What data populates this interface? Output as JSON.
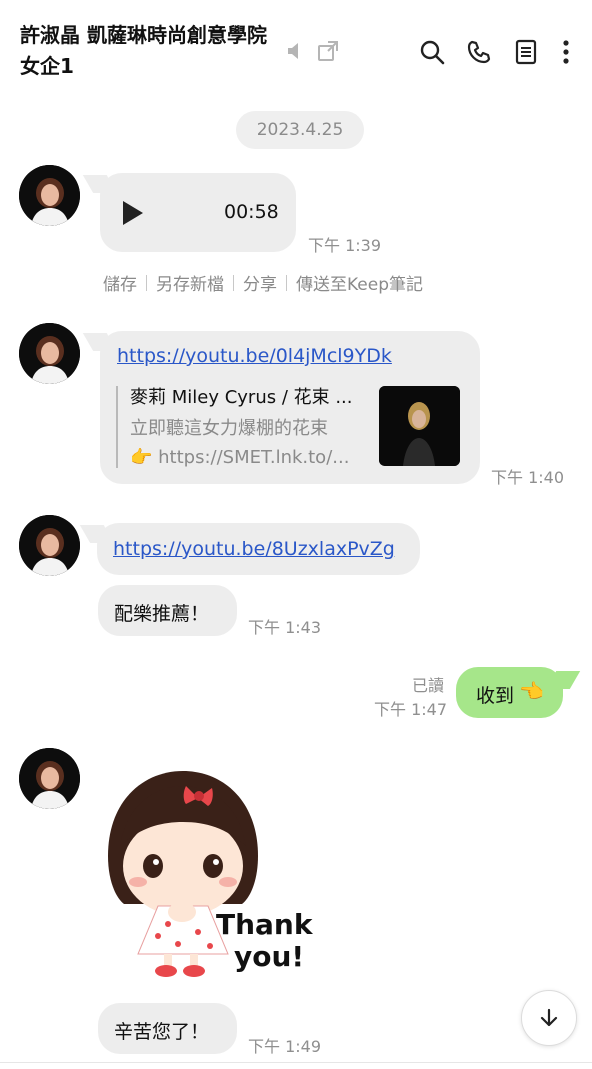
{
  "header": {
    "title": "許淑晶 凱薩琳時尚創意學院 女企1",
    "icons": [
      "mute-icon",
      "external-link-icon",
      "search-icon",
      "phone-icon",
      "notes-icon",
      "more-icon"
    ]
  },
  "date_divider": "2023.4.25",
  "messages": {
    "voice": {
      "duration": "00:58",
      "time": "下午 1:39"
    },
    "voice_actions": [
      "儲存",
      "另存新檔",
      "分享",
      "傳送至Keep筆記"
    ],
    "link_preview": {
      "url": "https://youtu.be/0l4jMcl9YDk",
      "title": "麥莉 Miley Cyrus / 花束 ...",
      "desc_line1": "立即聽這女力爆棚的花束",
      "desc_line2": "👉 https://SMET.lnk.to/...",
      "time": "下午 1:40"
    },
    "link2": {
      "url": "https://youtu.be/8UzxlaxPvZg"
    },
    "text1": {
      "text": "配樂推薦！",
      "time": "下午 1:43"
    },
    "outgoing": {
      "read_label": "已讀",
      "text": "收到",
      "emoji": "👈",
      "time": "下午 1:47"
    },
    "sticker": {
      "line1": "Thank",
      "line2": "you!"
    },
    "text2": {
      "text": "辛苦您了！",
      "time": "下午 1:49"
    }
  },
  "colors": {
    "incoming_bubble": "#ededed",
    "outgoing_bubble": "#a6e68a",
    "link": "#2a57c8",
    "muted_text": "#8f8f8f"
  }
}
